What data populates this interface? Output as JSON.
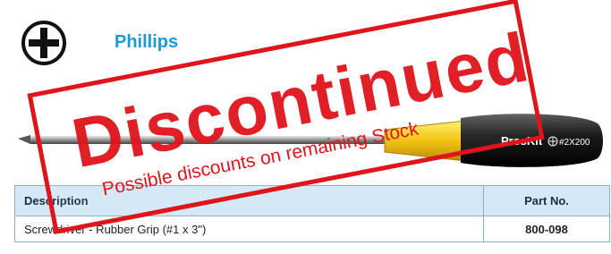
{
  "header": {
    "symbol_icon": "phillips-cross-icon",
    "title": "Phillips"
  },
  "product_image": {
    "handle_brand": "ProsKit",
    "handle_model": "#2X200"
  },
  "table": {
    "headers": [
      "Description",
      "Part No."
    ],
    "rows": [
      {
        "description": "Screwdriver - Rubber Grip (#1 x 3\")",
        "part_no": "800-098"
      }
    ]
  },
  "stamp": {
    "main_text": "Discontinued",
    "sub_text": "Possible discounts on remaining Stock"
  },
  "colors": {
    "title": "#1a9ad6",
    "stamp": "#e0141b",
    "table_header_bg": "#d4e8f6"
  }
}
